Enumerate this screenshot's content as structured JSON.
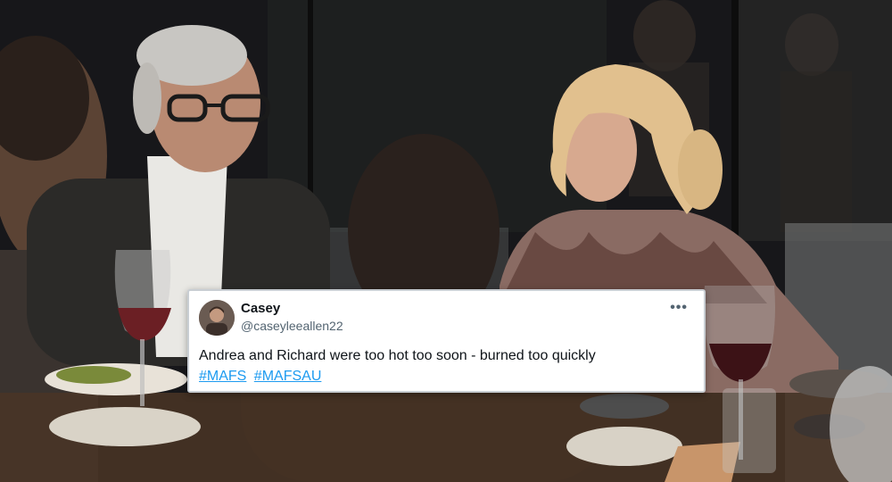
{
  "tweet": {
    "display_name": "Casey",
    "handle": "@caseyleeallen22",
    "text": "Andrea and Richard were too hot too soon - burned too quickly",
    "hashtags": [
      "#MAFS",
      "#MAFSAU"
    ],
    "more_icon": "ellipsis-icon",
    "colors": {
      "link": "#1d9bf0",
      "text": "#0f1419",
      "muted": "#536471"
    }
  }
}
